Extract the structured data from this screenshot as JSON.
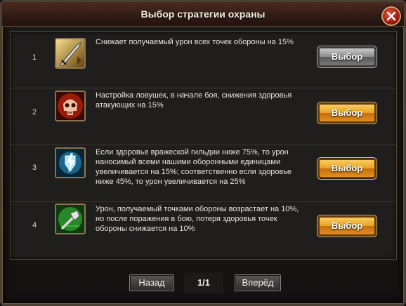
{
  "dialog": {
    "title": "Выбор стратегии охраны",
    "close_icon": "close-icon"
  },
  "strategies": [
    {
      "number": "1",
      "icon": "sword-icon",
      "description": "Снижает получаемый урон всех точек обороны на 15%",
      "button_label": "Выбор",
      "button_state": "disabled"
    },
    {
      "number": "2",
      "icon": "skull-icon",
      "description": "Настройка ловушек, в начале боя, снижения здоровья атакующих на 15%",
      "button_label": "Выбор",
      "button_state": "active"
    },
    {
      "number": "3",
      "icon": "lightning-shield-icon",
      "description": "Если здоровье вражеской гильдии ниже 75%, то урон наносимый всеми нашими оборонными единицами увеличивается на 15%; соответственно если здоровье ниже 45%, то урон увеличивается на 25%",
      "button_label": "Выбор",
      "button_state": "active"
    },
    {
      "number": "4",
      "icon": "hammer-icon",
      "description": "Урон, получаемый точками обороны возрастает на 10%, но после поражения в бою, потеря здоровья точек обороны снижается на 10%",
      "button_label": "Выбор",
      "button_state": "active"
    }
  ],
  "pagination": {
    "back_label": "Назад",
    "page": "1/1",
    "forward_label": "Вперёд"
  },
  "colors": {
    "button_active": "#e8a224",
    "button_disabled": "#8c8c8c",
    "title_bar": "#301a14"
  }
}
